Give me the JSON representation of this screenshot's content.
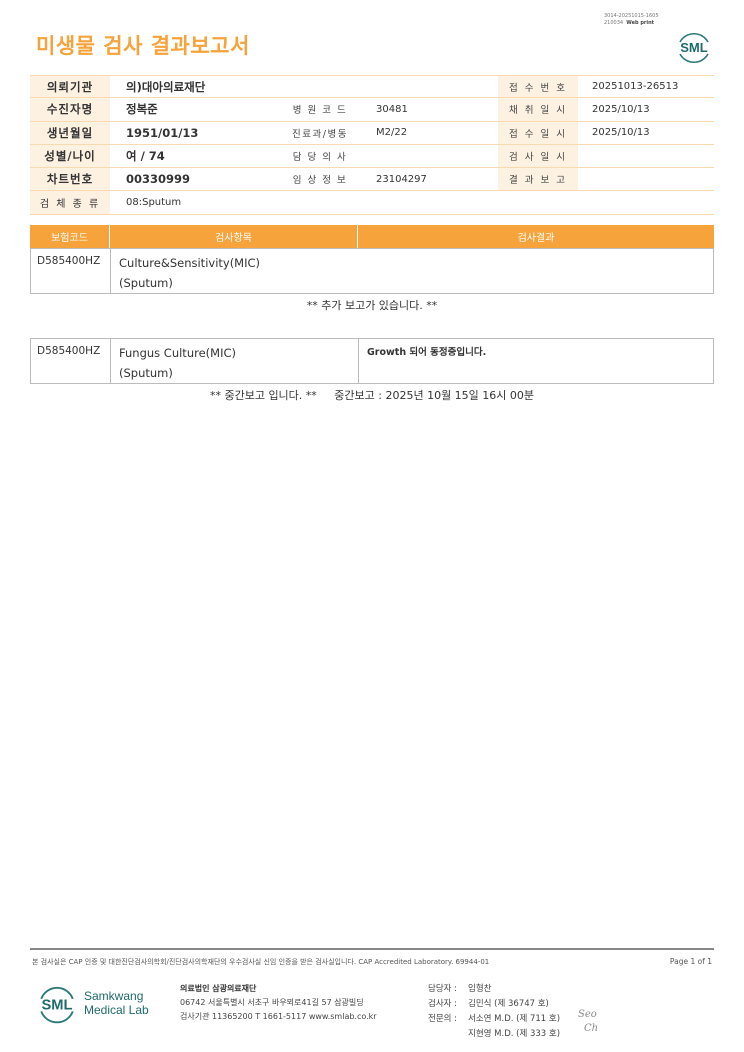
{
  "header": {
    "title": "미생물 검사 결과보고서",
    "print_id": "3014-20251015-1605",
    "print_id2": "210034",
    "print_type": "Web print",
    "logo_text": "SML"
  },
  "patient": {
    "rows": [
      {
        "l1": "의뢰기관",
        "v1": "의)대아의료재단",
        "l2": "",
        "v2": "",
        "l3": "접 수 번 호",
        "v3": "20251013-26513"
      },
      {
        "l1": "수진자명",
        "v1": "정복준",
        "l2": "병 원 코 드",
        "v2": "30481",
        "l3": "채 취 일 시",
        "v3": "2025/10/13"
      },
      {
        "l1": "생년월일",
        "v1": "1951/01/13",
        "l2": "진료과/병동",
        "v2": "M2/22",
        "l3": "접 수 일 시",
        "v3": "2025/10/13"
      },
      {
        "l1": "성별/나이",
        "v1": "여 / 74",
        "l2": "담 당 의 사",
        "v2": "",
        "l3": "검 사 일 시",
        "v3": ""
      },
      {
        "l1": "차트번호",
        "v1": "00330999",
        "l2": "임 상 정 보",
        "v2": "23104297",
        "l3": "결 과 보 고",
        "v3": ""
      },
      {
        "l1": "검 체 종 류",
        "v1": "08:Sputum",
        "l2": "",
        "v2": "",
        "l3": "",
        "v3": ""
      }
    ]
  },
  "results": {
    "headers": {
      "code": "보험코드",
      "item": "검사항목",
      "result": "검사결과"
    },
    "entries": [
      {
        "code": "D585400HZ",
        "item": "Culture&Sensitivity(MIC)",
        "specimen": "(Sputum)",
        "result": "",
        "note": "** 추가 보고가 있습니다. **"
      },
      {
        "code": "D585400HZ",
        "item": "Fungus Culture(MIC)",
        "specimen": "(Sputum)",
        "result": "Growth 되어 동정중입니다.",
        "note": "** 중간보고 입니다. **     중간보고 : 2025년 10월 15일 16시 00분"
      }
    ]
  },
  "footer": {
    "cert": "본 검사실은 CAP 인증 및 대한진단검사의학회/진단검사의학재단의 우수검사실 신임 인증을 받은 검사실입니다.  CAP Accredited Laboratory. 69944-01",
    "page": "Page 1 of 1",
    "brand_line1": "Samkwang",
    "brand_line2": "Medical Lab",
    "org_name": "의료법인 삼광의료재단",
    "address": "06742 서울특별시 서초구 바우뫼로41길 57 삼광빌딩",
    "contact": "검사기관 11365200  T 1661-5117  www.smlab.co.kr",
    "staff": [
      {
        "key": "담당자 :",
        "value": "임형찬"
      },
      {
        "key": "검사자 :",
        "value": "김민식 (제 36747 호)"
      },
      {
        "key": "전문의 :",
        "value": "서소연 M.D. (제 711 호)"
      },
      {
        "key": "",
        "value": "지현영 M.D. (제 333 호)"
      }
    ],
    "sign1": "Seo",
    "sign2": "Ch"
  }
}
